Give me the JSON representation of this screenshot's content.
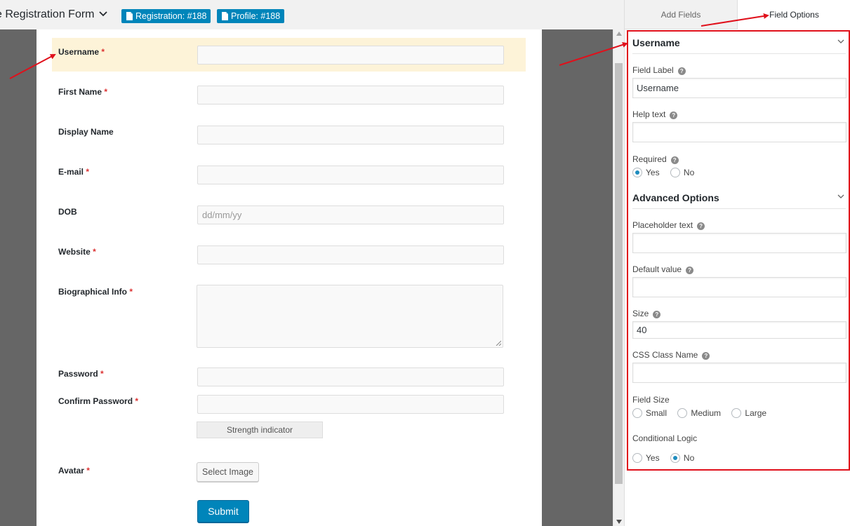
{
  "header": {
    "title": "e Registration Form",
    "badges": [
      {
        "label": "Registration: #188"
      },
      {
        "label": "Profile: #188"
      }
    ]
  },
  "form": {
    "fields": [
      {
        "label": "Username",
        "required": "*",
        "placeholder": ""
      },
      {
        "label": "First Name",
        "required": "*",
        "placeholder": ""
      },
      {
        "label": "Display Name",
        "required": "",
        "placeholder": ""
      },
      {
        "label": "E-mail",
        "required": "*",
        "placeholder": ""
      },
      {
        "label": "DOB",
        "required": "",
        "placeholder": "dd/mm/yy"
      },
      {
        "label": "Website",
        "required": "*",
        "placeholder": ""
      },
      {
        "label": "Biographical Info",
        "required": "*",
        "placeholder": ""
      },
      {
        "label": "Password",
        "required": "*",
        "placeholder": ""
      },
      {
        "label": "Confirm Password",
        "required": "*",
        "placeholder": ""
      },
      {
        "label": "Avatar",
        "required": "*",
        "placeholder": ""
      }
    ],
    "strength_label": "Strength indicator",
    "select_image_label": "Select Image",
    "submit_label": "Submit"
  },
  "sidebar": {
    "tabs": [
      {
        "label": "Add Fields"
      },
      {
        "label": "Field Options"
      }
    ],
    "section_title": "Username",
    "field_label": {
      "label": "Field Label",
      "value": "Username"
    },
    "help_text": {
      "label": "Help text",
      "value": ""
    },
    "required": {
      "label": "Required",
      "options": [
        "Yes",
        "No"
      ],
      "selected": "Yes"
    },
    "advanced_title": "Advanced Options",
    "placeholder_text": {
      "label": "Placeholder text",
      "value": ""
    },
    "default_value": {
      "label": "Default value",
      "value": ""
    },
    "size": {
      "label": "Size",
      "value": "40"
    },
    "css_class": {
      "label": "CSS Class Name",
      "value": ""
    },
    "field_size": {
      "label": "Field Size",
      "options": [
        "Small",
        "Medium",
        "Large"
      ],
      "selected": ""
    },
    "conditional_logic": {
      "label": "Conditional Logic",
      "options": [
        "Yes",
        "No"
      ],
      "selected": "No"
    }
  },
  "colors": {
    "accent": "#0085ba",
    "highlight_row": "#fdf3d8",
    "annotation": "#e0101b"
  }
}
